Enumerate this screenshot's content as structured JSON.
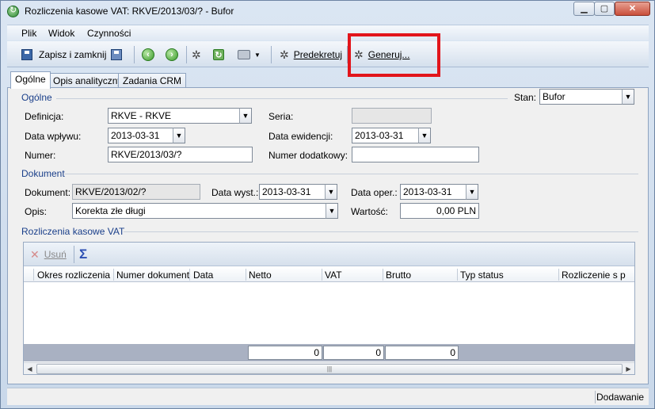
{
  "window": {
    "title": "Rozliczenia kasowe VAT: RKVE/2013/03/? - Bufor"
  },
  "menu": {
    "file": "Plik",
    "view": "Widok",
    "actions": "Czynności"
  },
  "toolbar": {
    "save_close": "Zapisz i zamknij",
    "predekretuj": "Predekretuj",
    "generuj": "Generuj...",
    "highlight_color": "#e2151b"
  },
  "tabs": [
    "Ogólne",
    "Opis analityczny",
    "Zadania CRM"
  ],
  "general": {
    "group_label": "Ogólne",
    "status_label": "Stan:",
    "status_value": "Bufor",
    "definition_label": "Definicja:",
    "definition_value": "RKVE - RKVE",
    "series_label": "Seria:",
    "series_value": "",
    "receipt_date_label": "Data wpływu:",
    "receipt_date_value": "2013-03-31",
    "record_date_label": "Data ewidencji:",
    "record_date_value": "2013-03-31",
    "number_label": "Numer:",
    "number_value": "RKVE/2013/03/?",
    "extra_number_label": "Numer dodatkowy:",
    "extra_number_value": ""
  },
  "document": {
    "group_label": "Dokument",
    "document_label": "Dokument:",
    "document_value": "RKVE/2013/02/?",
    "issue_date_label": "Data wyst.:",
    "issue_date_value": "2013-03-31",
    "operation_date_label": "Data oper.:",
    "operation_date_value": "2013-03-31",
    "description_label": "Opis:",
    "description_value": "Korekta złe długi",
    "value_label": "Wartość:",
    "value_value": "0,00 PLN"
  },
  "vat": {
    "group_label": "Rozliczenia kasowe VAT",
    "remove_label": "Usuń",
    "columns": [
      "Okres rozliczenia",
      "Numer dokument",
      "Data",
      "Netto",
      "VAT",
      "Brutto",
      "Typ status",
      "Rozliczenie s p"
    ],
    "sums": {
      "netto": "0",
      "vat": "0",
      "brutto": "0"
    }
  },
  "status_bar": {
    "mode": "Dodawanie"
  }
}
